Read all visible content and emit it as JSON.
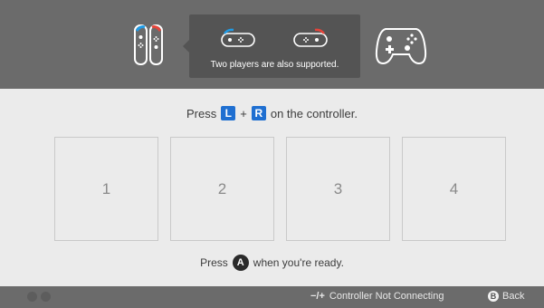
{
  "header": {
    "tooltip_text": "Two players are also supported.",
    "icons": [
      "dual-joycon-icon",
      "sideways-joycon-left-icon",
      "sideways-joycon-right-icon",
      "pro-controller-icon"
    ]
  },
  "instruction": {
    "prefix": "Press",
    "left_key": "L",
    "plus": "+",
    "right_key": "R",
    "suffix": "on the controller."
  },
  "slots": [
    "1",
    "2",
    "3",
    "4"
  ],
  "ready": {
    "prefix": "Press",
    "button": "A",
    "suffix": "when you're ready."
  },
  "footer": {
    "hint_symbol": "−/+",
    "hint_label": "Controller Not Connecting",
    "back_button": "B",
    "back_label": "Back"
  },
  "colors": {
    "header_bg": "#6b6b6b",
    "body_bg": "#ebebeb",
    "key_blue": "#1f6fd1",
    "joycon_blue": "#1f9be6",
    "joycon_red": "#e6443a"
  }
}
